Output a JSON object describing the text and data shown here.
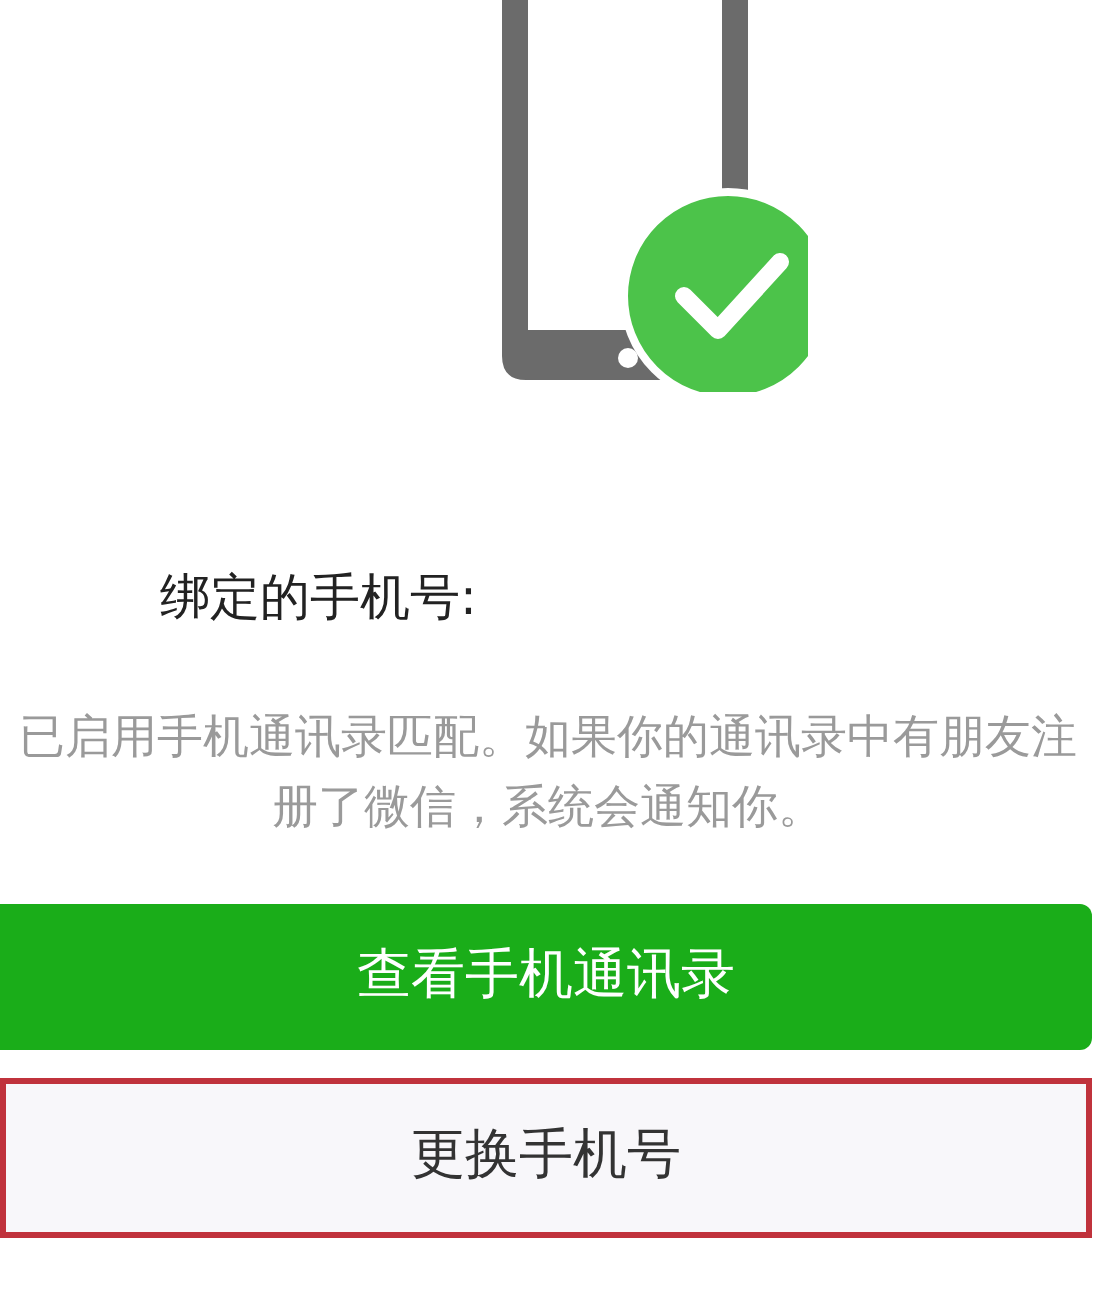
{
  "title": "绑定的手机号:",
  "description": "已启用手机通讯录匹配。如果你的通讯录中有朋友注册了微信，系统会通知你。",
  "buttons": [
    {
      "label": "查看手机通讯录",
      "kind": "primary",
      "highlighted": false
    },
    {
      "label": "更换手机号",
      "kind": "secondary",
      "highlighted": true
    }
  ]
}
